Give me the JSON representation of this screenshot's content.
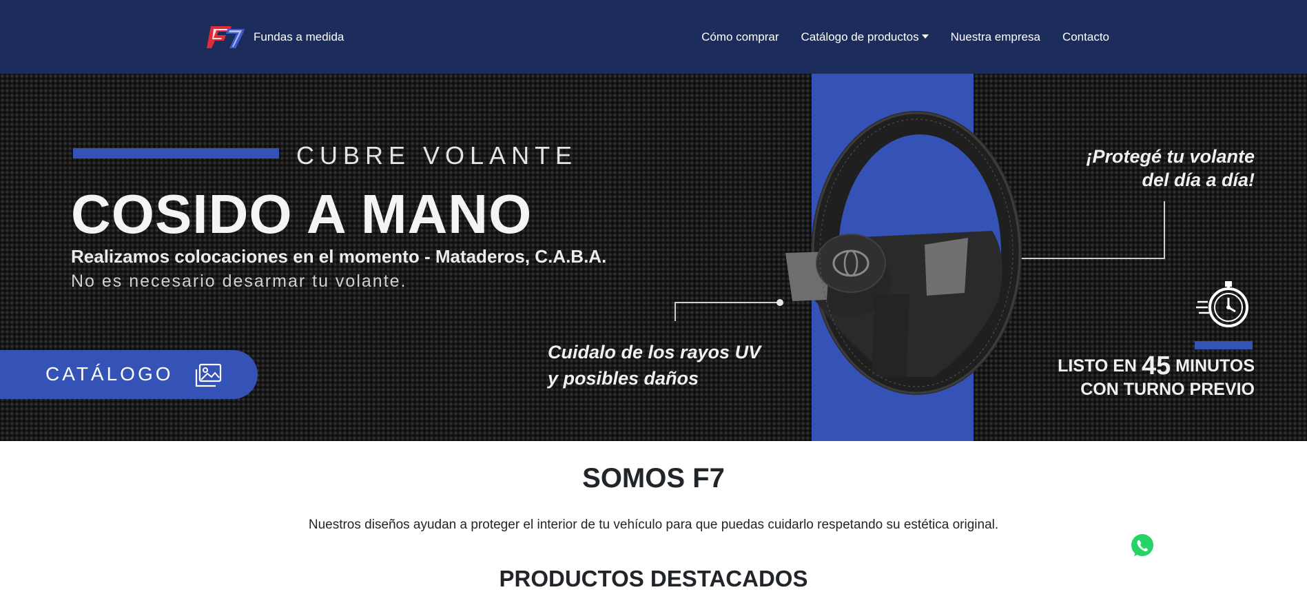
{
  "navbar": {
    "brand_text": "Fundas a medida",
    "logo_icon": "f7-logo",
    "links": [
      {
        "label": "Cómo comprar"
      },
      {
        "label": "Catálogo de productos",
        "dropdown": true
      },
      {
        "label": "Nuestra empresa"
      },
      {
        "label": "Contacto"
      }
    ]
  },
  "hero": {
    "subtitle": "CUBRE VOLANTE",
    "title": "COSIDO A MANO",
    "line1": "Realizamos colocaciones en el momento - Mataderos, C.A.B.A.",
    "line2": "No es necesario desarmar tu volante.",
    "catalog_button": "CATÁLOGO",
    "catalog_icon": "image-gallery-icon",
    "uv_line1": "Cuidalo de los rayos UV",
    "uv_line2": "y posibles daños",
    "protect_line1": "¡Protegé tu volante",
    "protect_line2": "del día a día!",
    "timer_icon": "stopwatch-icon",
    "ready_pre": "LISTO EN",
    "ready_number": "45",
    "ready_post": "MINUTOS",
    "ready_line2": "CON TURNO PREVIO",
    "image": "steering-wheel-with-cover",
    "accent_color": "#3553b6"
  },
  "content": {
    "heading": "SOMOS F7",
    "description": "Nuestros diseños ayudan a proteger el interior de tu vehículo para que puedas cuidarlo respetando su estética original.",
    "featured_heading": "PRODUCTOS DESTACADOS"
  },
  "floating": {
    "whatsapp_icon": "whatsapp-icon",
    "color": "#25d366"
  },
  "colors": {
    "navbar_bg": "#1c2c5b",
    "accent": "#3553b6"
  }
}
